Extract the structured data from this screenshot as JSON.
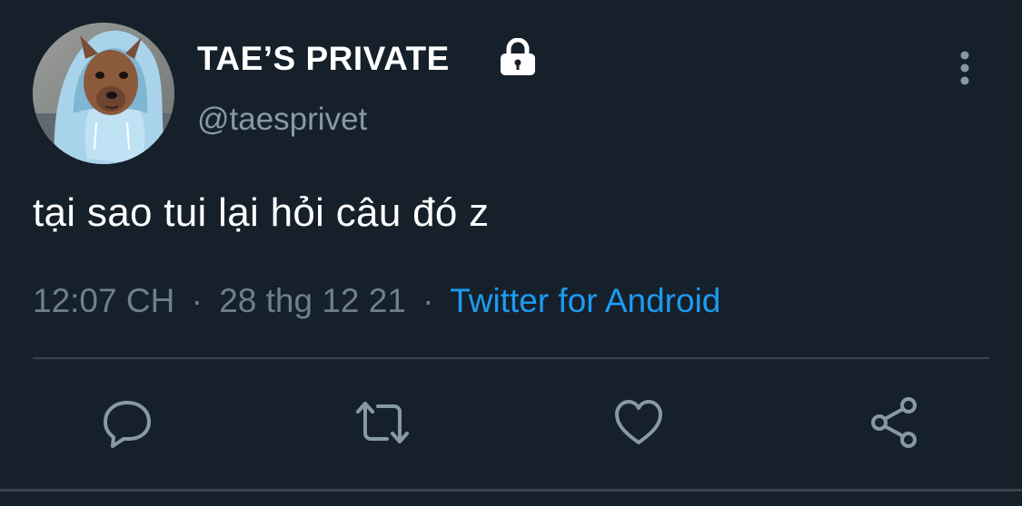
{
  "tweet": {
    "display_name": "TAE’S PRIVATE",
    "handle": "@taesprivet",
    "text": "tại sao tui lại hỏi câu đó z",
    "time": "12:07 CH",
    "date": "28 thg 12 21",
    "separator": "·",
    "source": "Twitter for Android"
  },
  "icons": {
    "lock": "lock-icon",
    "more": "more-vertical-icon",
    "reply": "reply-icon",
    "retweet": "retweet-icon",
    "like": "heart-icon",
    "share": "share-icon"
  },
  "colors": {
    "background": "#15202b",
    "text_primary": "#ffffff",
    "text_secondary": "#8899a6",
    "link": "#1d9bf0",
    "divider": "#38444d",
    "icon": "#8899a6"
  }
}
